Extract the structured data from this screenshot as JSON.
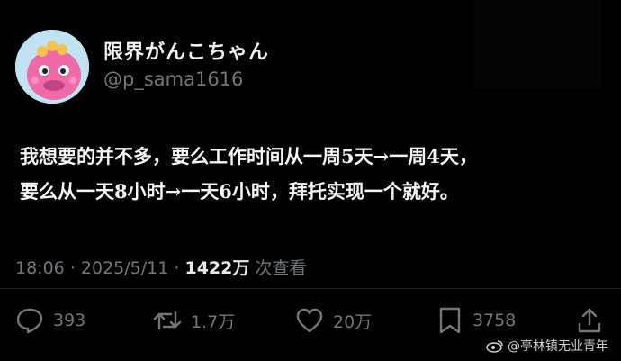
{
  "author": {
    "display_name": "限界がんこちゃん",
    "handle": "@p_sama1616",
    "avatar_icon": "pink-dinosaur-avatar"
  },
  "tweet": {
    "text_lines": [
      "我想要的并不多，要么工作时间从一周5天→一周4天，",
      "要么从一天8小时→一天6小时，拜托实现一个就好。"
    ]
  },
  "meta": {
    "time": "18:06",
    "separator": "·",
    "date": "2025/5/11",
    "views_count": "1422万",
    "views_label": "次查看"
  },
  "actions": {
    "reply": {
      "icon": "reply-bubble-icon",
      "count": "393"
    },
    "retweet": {
      "icon": "retweet-icon",
      "count": "1.7万"
    },
    "like": {
      "icon": "heart-icon",
      "count": "20万"
    },
    "bookmark": {
      "icon": "bookmark-icon",
      "count": "3758"
    },
    "share": {
      "icon": "share-icon"
    }
  },
  "watermark": {
    "text": "@亭林镇无业青年",
    "icon": "weibo-icon"
  },
  "colors": {
    "background": "#000000",
    "primary_text": "#e7e9ea",
    "secondary_text": "#71767b",
    "avatar_bg": "#bfe3f3",
    "avatar_pink": "#f06aa8"
  }
}
